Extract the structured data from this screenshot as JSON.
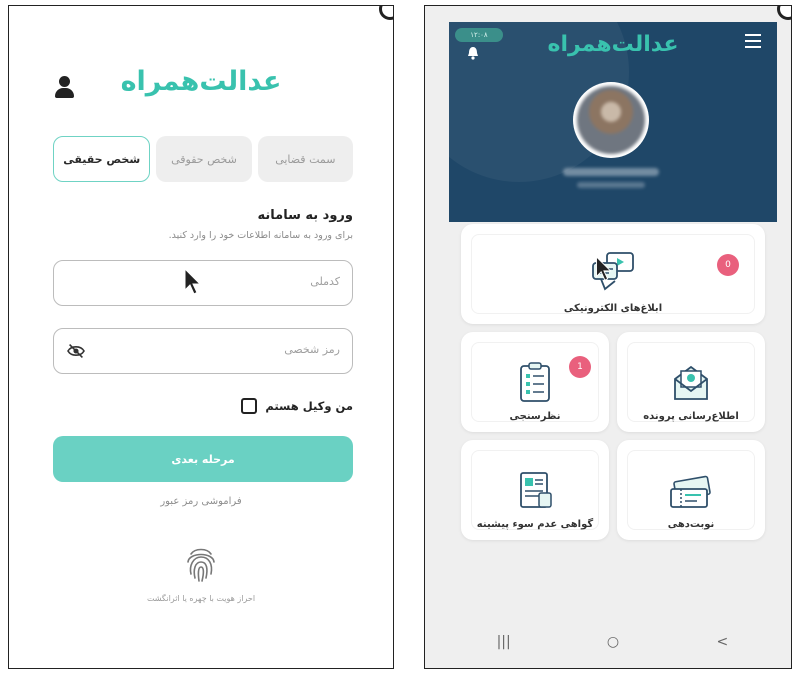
{
  "login": {
    "brand": "عدالت‌همراه",
    "tabs": [
      {
        "label": "شخص حقیقی",
        "active": true
      },
      {
        "label": "شخص حقوقی",
        "active": false
      },
      {
        "label": "سمت قضایی",
        "active": false
      }
    ],
    "title": "ورود به سامانه",
    "subtitle": "برای ورود به سامانه اطلاعات خود را وارد کنید.",
    "national_code_placeholder": "کدملی",
    "password_placeholder": "رمز شخصی",
    "lawyer_checkbox_label": "من وکیل هستم",
    "lawyer_checked": false,
    "next_button": "مرحله بعدی",
    "forgot_password": "فراموشی رمز عبور",
    "auth_caption": "احراز هویت با چهره یا اثرانگشت",
    "icons": [
      "user-icon",
      "eye-slash-icon",
      "fingerprint-icon",
      "cursor-icon"
    ]
  },
  "dashboard": {
    "brand": "عدالت‌همراه",
    "status_time": "۱۲:۰۸",
    "cards": {
      "notices": {
        "label": "ابلاغ‌های الکترونیکی",
        "badge": "0"
      },
      "case_info": {
        "label": "اطلاع‌رسانی پرونده"
      },
      "survey": {
        "label": "نظرسنجی",
        "badge": "1"
      },
      "appointment": {
        "label": "نوبت‌دهی"
      },
      "clearance": {
        "label": "گواهی عدم سوء پیشینه"
      }
    },
    "nav": [
      "|||",
      "○",
      "<"
    ],
    "colors": {
      "header": "#1f4768",
      "accent": "#39c2ae",
      "badge": "#e9607d"
    },
    "icons": [
      "menu-icon",
      "bell-icon",
      "avatar",
      "notice-icon",
      "case-info-icon",
      "survey-icon",
      "appointment-icon",
      "clearance-icon"
    ]
  }
}
